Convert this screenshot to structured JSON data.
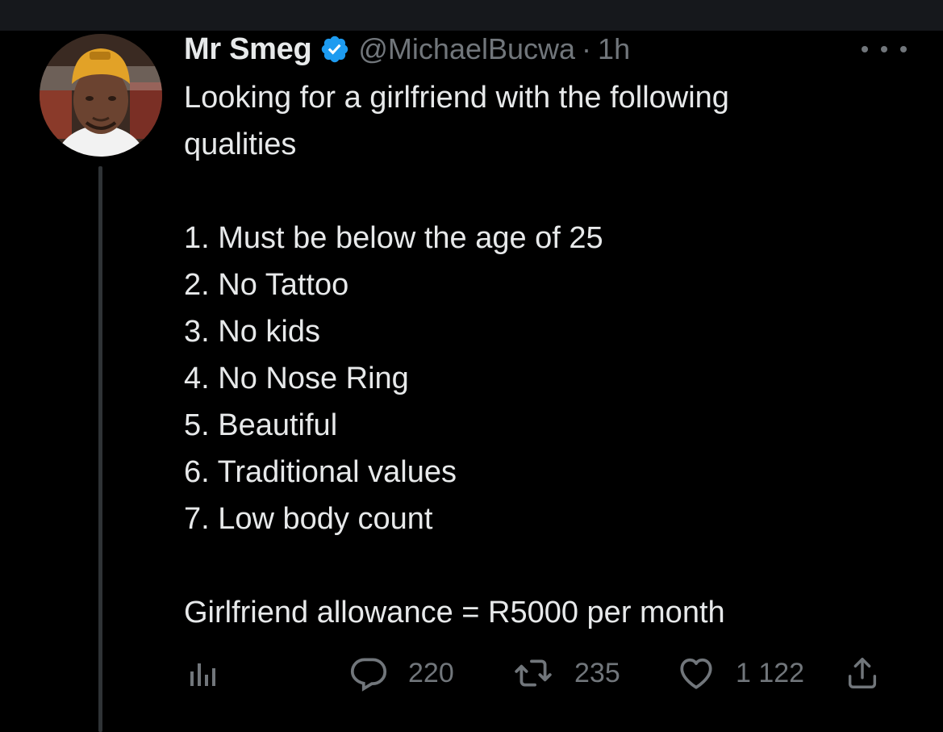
{
  "user": {
    "display_name": "Mr Smeg",
    "handle": "@MichaelBucwa",
    "separator": "·",
    "time": "1h",
    "verified_color": "#1d9bf0"
  },
  "tweet": {
    "intro_1": "Looking for a girlfriend with the following",
    "intro_2": "qualities",
    "items": [
      "1. Must be below the age of 25",
      "2. No Tattoo",
      "3. No kids",
      "4. No Nose Ring",
      "5. Beautiful",
      "6. Traditional values",
      "7. Low body count"
    ],
    "closing": "Girlfriend allowance = R5000 per month"
  },
  "actions": {
    "replies": "220",
    "retweets": "235",
    "likes": "1 122"
  },
  "icons": {
    "more": "more-icon",
    "analytics": "analytics-icon",
    "reply": "reply-icon",
    "retweet": "retweet-icon",
    "like": "heart-icon",
    "share": "share-icon"
  },
  "colors": {
    "background": "#000000",
    "text": "#e7e9ea",
    "muted": "#71767b",
    "thread_line": "#2f3336"
  }
}
